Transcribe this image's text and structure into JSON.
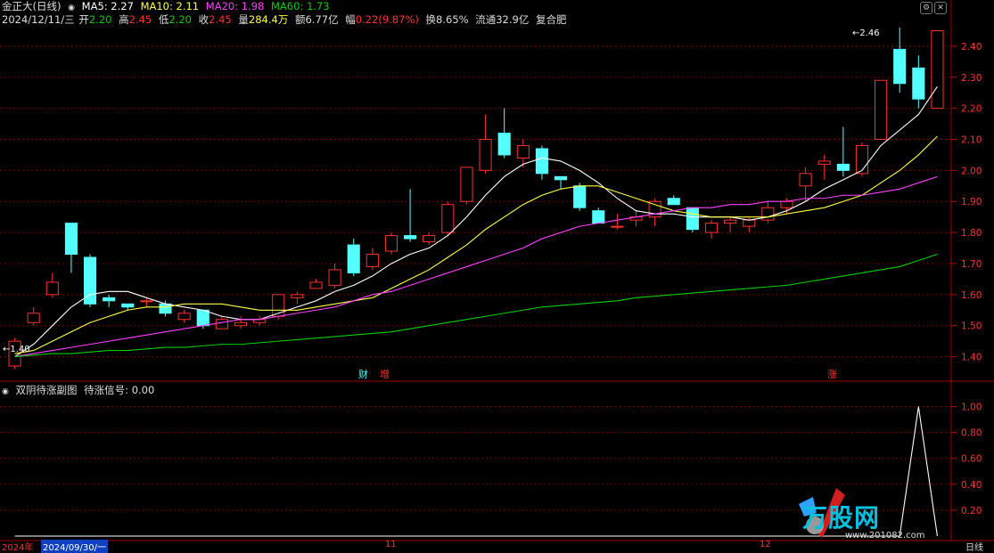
{
  "header": {
    "stock_name": "金正大(日线)",
    "ma5": "MA5: 2.27",
    "ma10": "MA10: 2.11",
    "ma20": "MA20: 1.98",
    "ma60": "MA60: 1.73",
    "date": "2024/12/11/三",
    "open_label": "开",
    "open_value": "2.20",
    "high_label": "高",
    "high_value": "2.45",
    "low_label": "低",
    "low_value": "2.20",
    "close_label": "收",
    "close_value": "2.45",
    "volume_label": "量",
    "volume_value": "284.4万",
    "amount_label": "额",
    "amount_value": "6.77亿",
    "change_label": "幅",
    "change_value": "0.22(9.87%)",
    "turnover": "换8.65%",
    "float_cap": "流通32.9亿",
    "region": "复合肥"
  },
  "sub_panel": {
    "title": "双阴待涨副图",
    "signal": "待涨信号: 0.00",
    "y_ticks": [
      "1.00",
      "0.80",
      "0.60",
      "0.40",
      "0.20"
    ]
  },
  "markers": {
    "cai": "财",
    "zeng": "增",
    "zhang": "涨",
    "low_marker": "1.40",
    "high_marker": "2.46"
  },
  "y_ticks": [
    "2.40",
    "2.30",
    "2.20",
    "2.10",
    "2.00",
    "1.90",
    "1.80",
    "1.70",
    "1.60",
    "1.50",
    "1.40"
  ],
  "x_axis": {
    "year_label": "2024年",
    "cursor_date": "2024/09/30/一",
    "month_11": "11",
    "month_12": "12",
    "period": "日线"
  },
  "watermark": {
    "brand": "万股网",
    "url": "www.201082.com"
  },
  "colors": {
    "up": "#ff3030",
    "down": "#54ffff",
    "ma5": "#ffffff",
    "ma10": "#ffff40",
    "ma20": "#ff40ff",
    "ma60": "#00d000",
    "grid": "#7a0000"
  },
  "chart_data": {
    "type": "candlestick",
    "ylim": [
      1.35,
      2.48
    ],
    "candles": [
      {
        "o": 1.37,
        "h": 1.46,
        "l": 1.36,
        "c": 1.45
      },
      {
        "o": 1.51,
        "h": 1.56,
        "l": 1.5,
        "c": 1.54
      },
      {
        "o": 1.6,
        "h": 1.67,
        "l": 1.59,
        "c": 1.64
      },
      {
        "o": 1.83,
        "h": 1.83,
        "l": 1.67,
        "c": 1.73
      },
      {
        "o": 1.72,
        "h": 1.73,
        "l": 1.56,
        "c": 1.57
      },
      {
        "o": 1.59,
        "h": 1.6,
        "l": 1.56,
        "c": 1.58
      },
      {
        "o": 1.57,
        "h": 1.57,
        "l": 1.55,
        "c": 1.56
      },
      {
        "o": 1.58,
        "h": 1.59,
        "l": 1.56,
        "c": 1.58
      },
      {
        "o": 1.57,
        "h": 1.58,
        "l": 1.53,
        "c": 1.54
      },
      {
        "o": 1.52,
        "h": 1.55,
        "l": 1.51,
        "c": 1.54
      },
      {
        "o": 1.55,
        "h": 1.55,
        "l": 1.49,
        "c": 1.5
      },
      {
        "o": 1.49,
        "h": 1.53,
        "l": 1.49,
        "c": 1.52
      },
      {
        "o": 1.5,
        "h": 1.53,
        "l": 1.49,
        "c": 1.51
      },
      {
        "o": 1.51,
        "h": 1.53,
        "l": 1.5,
        "c": 1.52
      },
      {
        "o": 1.53,
        "h": 1.6,
        "l": 1.52,
        "c": 1.6
      },
      {
        "o": 1.59,
        "h": 1.61,
        "l": 1.57,
        "c": 1.6
      },
      {
        "o": 1.62,
        "h": 1.65,
        "l": 1.62,
        "c": 1.64
      },
      {
        "o": 1.63,
        "h": 1.7,
        "l": 1.62,
        "c": 1.68
      },
      {
        "o": 1.76,
        "h": 1.78,
        "l": 1.66,
        "c": 1.67
      },
      {
        "o": 1.69,
        "h": 1.75,
        "l": 1.68,
        "c": 1.73
      },
      {
        "o": 1.74,
        "h": 1.8,
        "l": 1.73,
        "c": 1.79
      },
      {
        "o": 1.79,
        "h": 1.94,
        "l": 1.77,
        "c": 1.78
      },
      {
        "o": 1.77,
        "h": 1.8,
        "l": 1.76,
        "c": 1.79
      },
      {
        "o": 1.8,
        "h": 1.9,
        "l": 1.79,
        "c": 1.89
      },
      {
        "o": 1.9,
        "h": 2.01,
        "l": 1.89,
        "c": 2.01
      },
      {
        "o": 2.0,
        "h": 2.18,
        "l": 1.99,
        "c": 2.1
      },
      {
        "o": 2.12,
        "h": 2.2,
        "l": 2.04,
        "c": 2.05
      },
      {
        "o": 2.04,
        "h": 2.1,
        "l": 2.01,
        "c": 2.08
      },
      {
        "o": 2.07,
        "h": 2.08,
        "l": 1.97,
        "c": 1.99
      },
      {
        "o": 1.98,
        "h": 1.98,
        "l": 1.94,
        "c": 1.97
      },
      {
        "o": 1.95,
        "h": 1.96,
        "l": 1.87,
        "c": 1.88
      },
      {
        "o": 1.87,
        "h": 1.88,
        "l": 1.83,
        "c": 1.83
      },
      {
        "o": 1.82,
        "h": 1.86,
        "l": 1.81,
        "c": 1.82
      },
      {
        "o": 1.84,
        "h": 1.87,
        "l": 1.82,
        "c": 1.85
      },
      {
        "o": 1.85,
        "h": 1.91,
        "l": 1.82,
        "c": 1.9
      },
      {
        "o": 1.91,
        "h": 1.92,
        "l": 1.89,
        "c": 1.89
      },
      {
        "o": 1.88,
        "h": 1.88,
        "l": 1.8,
        "c": 1.81
      },
      {
        "o": 1.8,
        "h": 1.84,
        "l": 1.78,
        "c": 1.83
      },
      {
        "o": 1.83,
        "h": 1.85,
        "l": 1.8,
        "c": 1.84
      },
      {
        "o": 1.82,
        "h": 1.85,
        "l": 1.8,
        "c": 1.84
      },
      {
        "o": 1.84,
        "h": 1.9,
        "l": 1.83,
        "c": 1.88
      },
      {
        "o": 1.88,
        "h": 1.91,
        "l": 1.86,
        "c": 1.9
      },
      {
        "o": 1.95,
        "h": 2.01,
        "l": 1.9,
        "c": 1.99
      },
      {
        "o": 2.02,
        "h": 2.05,
        "l": 1.97,
        "c": 2.03
      },
      {
        "o": 2.02,
        "h": 2.14,
        "l": 1.98,
        "c": 2.0
      },
      {
        "o": 1.99,
        "h": 2.09,
        "l": 1.98,
        "c": 2.08
      },
      {
        "o": 2.1,
        "h": 2.29,
        "l": 2.1,
        "c": 2.29
      },
      {
        "o": 2.39,
        "h": 2.46,
        "l": 2.25,
        "c": 2.28
      },
      {
        "o": 2.33,
        "h": 2.37,
        "l": 2.2,
        "c": 2.23
      },
      {
        "o": 2.2,
        "h": 2.45,
        "l": 2.2,
        "c": 2.45
      }
    ],
    "ma5": [
      1.4,
      1.44,
      1.5,
      1.56,
      1.6,
      1.61,
      1.61,
      1.59,
      1.57,
      1.56,
      1.55,
      1.53,
      1.52,
      1.52,
      1.54,
      1.56,
      1.58,
      1.61,
      1.63,
      1.66,
      1.7,
      1.73,
      1.75,
      1.79,
      1.85,
      1.92,
      1.98,
      2.02,
      2.04,
      2.03,
      2.0,
      1.96,
      1.91,
      1.87,
      1.86,
      1.86,
      1.85,
      1.85,
      1.85,
      1.84,
      1.85,
      1.87,
      1.9,
      1.94,
      1.97,
      2.0,
      2.08,
      2.13,
      2.18,
      2.27
    ],
    "ma10": [
      1.41,
      1.42,
      1.45,
      1.48,
      1.51,
      1.53,
      1.55,
      1.56,
      1.56,
      1.57,
      1.57,
      1.57,
      1.56,
      1.55,
      1.55,
      1.55,
      1.56,
      1.57,
      1.58,
      1.59,
      1.62,
      1.65,
      1.68,
      1.72,
      1.76,
      1.81,
      1.85,
      1.89,
      1.92,
      1.94,
      1.95,
      1.95,
      1.93,
      1.91,
      1.89,
      1.87,
      1.86,
      1.85,
      1.85,
      1.85,
      1.85,
      1.86,
      1.87,
      1.88,
      1.9,
      1.92,
      1.96,
      2.0,
      2.05,
      2.11
    ],
    "ma20": [
      1.4,
      1.41,
      1.42,
      1.43,
      1.44,
      1.45,
      1.46,
      1.47,
      1.48,
      1.49,
      1.5,
      1.51,
      1.52,
      1.52,
      1.53,
      1.54,
      1.55,
      1.56,
      1.58,
      1.6,
      1.61,
      1.63,
      1.65,
      1.67,
      1.69,
      1.71,
      1.73,
      1.75,
      1.78,
      1.8,
      1.82,
      1.83,
      1.84,
      1.85,
      1.86,
      1.87,
      1.88,
      1.88,
      1.89,
      1.89,
      1.9,
      1.9,
      1.91,
      1.91,
      1.92,
      1.92,
      1.93,
      1.94,
      1.96,
      1.98
    ],
    "ma60": [
      1.4,
      1.405,
      1.41,
      1.41,
      1.415,
      1.42,
      1.42,
      1.425,
      1.43,
      1.43,
      1.435,
      1.44,
      1.44,
      1.445,
      1.45,
      1.455,
      1.46,
      1.465,
      1.47,
      1.475,
      1.48,
      1.49,
      1.5,
      1.51,
      1.52,
      1.53,
      1.54,
      1.55,
      1.56,
      1.565,
      1.57,
      1.575,
      1.58,
      1.59,
      1.595,
      1.6,
      1.605,
      1.61,
      1.615,
      1.62,
      1.625,
      1.63,
      1.64,
      1.65,
      1.66,
      1.67,
      1.68,
      1.69,
      1.71,
      1.73
    ],
    "signal": [
      0,
      0,
      0,
      0,
      0,
      0,
      0,
      0,
      0,
      0,
      0,
      0,
      0,
      0,
      0,
      0,
      0,
      0,
      0,
      0,
      0,
      0,
      0,
      0,
      0,
      0,
      0,
      0,
      0,
      0,
      0,
      0,
      0,
      0,
      0,
      0,
      0,
      0,
      0,
      0,
      0,
      0,
      0,
      0,
      0,
      0,
      0,
      0,
      1,
      0
    ],
    "signal_ylim": [
      0,
      1.1
    ]
  }
}
